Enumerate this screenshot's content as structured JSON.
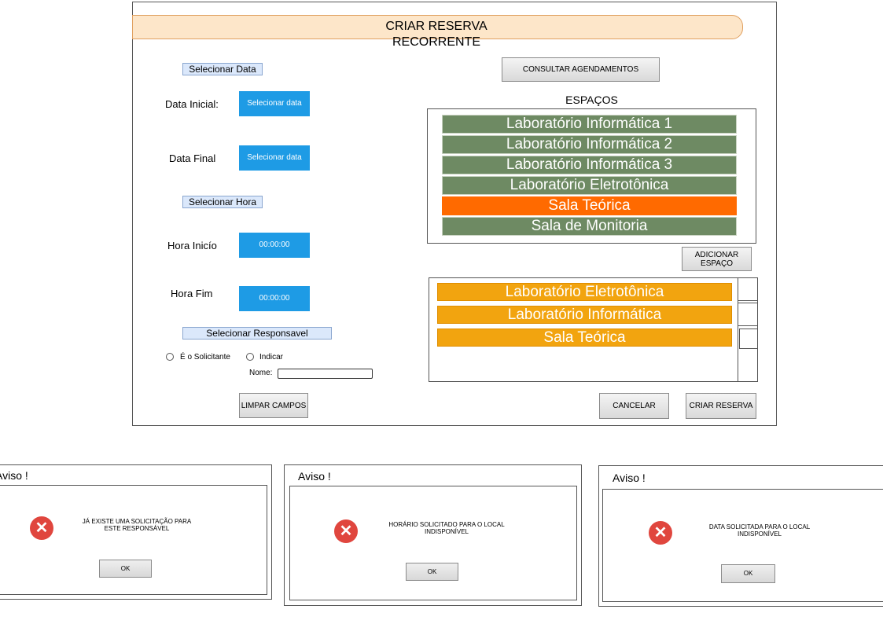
{
  "form": {
    "title_line1": "CRIAR RESERVA",
    "title_line2": "RECORRENTE",
    "section_date": "Selecionar Data",
    "label_start_date": "Data Inicial:",
    "start_date_button": "Selecionar data",
    "label_end_date": "Data Final",
    "end_date_button": "Selecionar data",
    "section_time": "Selecionar Hora",
    "label_start_time": "Hora Inicío",
    "start_time_value": "00:00:00",
    "label_end_time": "Hora Fim",
    "end_time_value": "00:00:00",
    "section_responsible": "Selecionar Responsavel",
    "radio_requester": "É o Solicitante",
    "radio_indicate": "Indicar",
    "label_name": "Nome:",
    "name_value": "",
    "clear_button": "LIMPAR CAMPOS",
    "consult_button": "CONSULTAR AGENDAMENTOS",
    "spaces_heading": "ESPAÇOS",
    "spaces": [
      {
        "label": "Laboratório Informática 1",
        "selected": false
      },
      {
        "label": "Laboratório Informática 2",
        "selected": false
      },
      {
        "label": "Laboratório Informática 3",
        "selected": false
      },
      {
        "label": "Laboratório Eletrotônica",
        "selected": false
      },
      {
        "label": "Sala Teórica",
        "selected": true
      },
      {
        "label": "Sala de Monitoria",
        "selected": false
      }
    ],
    "add_space_button_line1": "ADICIONAR",
    "add_space_button_line2": "ESPAÇO",
    "selected_spaces": [
      "Laboratório Eletrotônica",
      "Laboratório Informática",
      "Sala Teórica"
    ],
    "cancel_button": "CANCELAR",
    "create_button": "CRIAR RESERVA"
  },
  "dialogs": [
    {
      "title": "Aviso !",
      "message_line1": "JÁ EXISTE UMA SOLICITAÇÃO PARA",
      "message_line2": "ESTE RESPONSÁVEL",
      "ok": "OK"
    },
    {
      "title": "Aviso !",
      "message_line1": "HORÁRIO SOLICITADO PARA O LOCAL",
      "message_line2": "INDISPONÍVEL",
      "ok": "OK"
    },
    {
      "title": "Aviso !",
      "message_line1": "DATA SOLICITADA PARA O LOCAL",
      "message_line2": "INDISPONÍVEL",
      "ok": "OK"
    }
  ],
  "colors": {
    "title_bar": "#fde6c9",
    "blue_button": "#1e9be5",
    "space_item": "#6e8a63",
    "space_selected": "#ff6a00",
    "selected_item": "#f2a40f",
    "error_icon": "#e0463e"
  },
  "icons": {
    "error": "x-circle-icon"
  }
}
